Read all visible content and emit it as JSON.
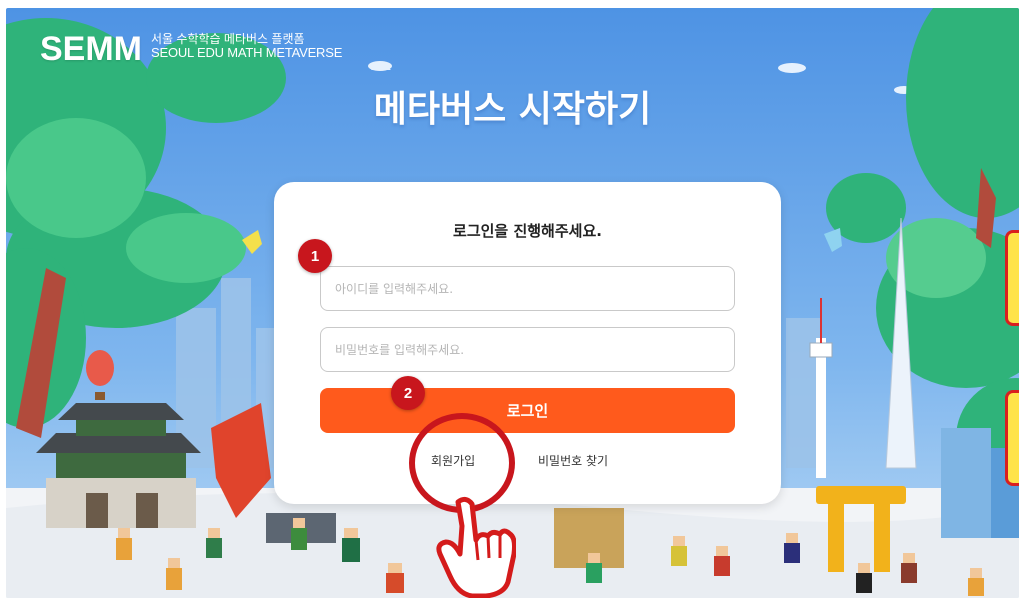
{
  "header": {
    "logo": "SEMM",
    "subtitle_ko": "서울 수학학습 메타버스 플랫폼",
    "subtitle_en": "SEOUL EDU MATH METAVERSE"
  },
  "page_title": "메타버스 시작하기",
  "login": {
    "title": "로그인을 진행해주세요.",
    "id_placeholder": "아이디를 입력해주세요.",
    "password_placeholder": "비밀번호를 입력해주세요.",
    "login_label": "로그인",
    "signup_label": "회원가입",
    "find_password_label": "비밀번호 찾기"
  },
  "annotations": {
    "step1": "1",
    "step2": "2"
  },
  "colors": {
    "sky": "#5aa2ea",
    "primary_button": "#ff5a1c",
    "annotation_red": "#c8161d",
    "card_bg": "#ffffff"
  }
}
